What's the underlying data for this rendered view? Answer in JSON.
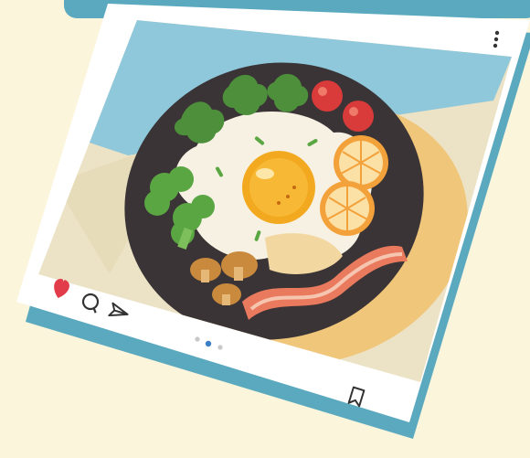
{
  "post": {
    "type": "social-media-food-post-illustration",
    "liked": true,
    "carousel": {
      "total_pages": 3,
      "active_page": 2
    },
    "icons": [
      "heart-icon",
      "comment-icon",
      "share-icon",
      "bookmark-icon",
      "more-options-icon"
    ]
  },
  "colors": {
    "background": "#fbf5dc",
    "banner": "#5aa9bf",
    "card_shadow": "#5aa9bf",
    "card": "#ffffff",
    "photo_sky": "#8fc8db",
    "photo_table": "#ece3c6",
    "pan": "#3a3436",
    "egg_white": "#f6f1e2",
    "yolk": "#f3a91f",
    "heart": "#e23b4a",
    "active_dot": "#3b7fc4"
  }
}
